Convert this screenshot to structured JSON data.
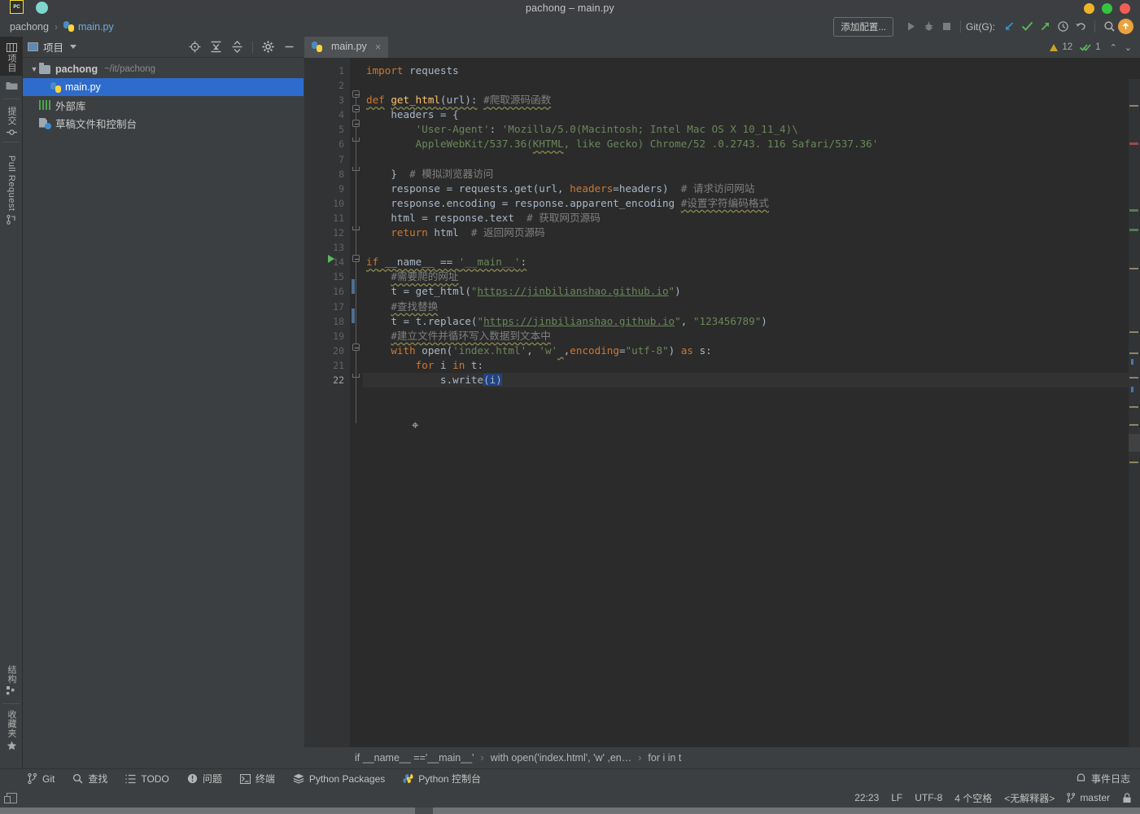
{
  "window": {
    "title": "pachong – main.py",
    "app_icon": "pycharm-logo-icon"
  },
  "navbar": {
    "project_crumb": "pachong",
    "separator": "›",
    "file_crumb": "main.py",
    "add_config_label": "添加配置...",
    "git_label": "Git(G):"
  },
  "toolstrip": {
    "top_items": [
      {
        "label": "项目",
        "icon": "project-icon",
        "active": true
      },
      {
        "label": "",
        "icon": "folder-icon",
        "active": false
      },
      {
        "label": "提交",
        "icon": "commit-icon",
        "active": false
      },
      {
        "label": "Pull Request",
        "icon": "pull-request-icon",
        "active": false
      }
    ],
    "bottom_items": [
      {
        "label": "结构",
        "icon": "structure-icon"
      },
      {
        "label": "收藏夹",
        "icon": "star-icon"
      }
    ]
  },
  "project_panel": {
    "title": "项目",
    "header_icons": [
      "locate-icon",
      "expand-all-icon",
      "collapse-all-icon",
      "gear-icon",
      "hide-icon"
    ],
    "tree": [
      {
        "label": "pachong",
        "path": "~/it/pachong",
        "icon": "folder-icon",
        "depth": 0,
        "expanded": true,
        "selected": false
      },
      {
        "label": "main.py",
        "path": "",
        "icon": "python-file-icon",
        "depth": 1,
        "expanded": false,
        "selected": true
      },
      {
        "label": "外部库",
        "path": "",
        "icon": "library-icon",
        "depth": 0,
        "expanded": false,
        "selected": false
      },
      {
        "label": "草稿文件和控制台",
        "path": "",
        "icon": "scratches-icon",
        "depth": 0,
        "expanded": false,
        "selected": false
      }
    ]
  },
  "editor": {
    "tab": {
      "label": "main.py",
      "icon": "python-file-icon",
      "close": "×"
    },
    "inspection": {
      "warning_count": "12",
      "check_count": "1",
      "up": "⌃",
      "down": "⌄"
    },
    "first_line": 1,
    "last_line": 22,
    "current_line": 22,
    "run_marker_line": 14,
    "changed_lines": [
      16,
      18
    ],
    "lines": [
      "import requests",
      "",
      "def get_html(url): #爬取源码函数",
      "    headers = {",
      "        'User-Agent': 'Mozilla/5.0(Macintosh; Intel Mac OS X 10_11_4)\\",
      "        AppleWebKit/537.36(KHTML, like Gecko) Chrome/52 .0.2743. 116 Safari/537.36'",
      "",
      "    }  # 模拟浏览器访问",
      "    response = requests.get(url, headers=headers)  # 请求访问网站",
      "    response.encoding = response.apparent_encoding #设置字符编码格式",
      "    html = response.text  # 获取网页源码",
      "    return html  # 返回网页源码",
      "",
      "if __name__ == '__main__':",
      "    #需要爬的网址",
      "    t = get_html(\"https://jinbilianshao.github.io\")",
      "    #查找替换",
      "    t = t.replace(\"https://jinbilianshao.github.io\", \"123456789\")",
      "    #建立文件并循环写入数据到文本中",
      "    with open('index.html', 'w' ,encoding=\"utf-8\") as s:",
      "        for i in t:",
      "            s.write(i)"
    ]
  },
  "bottom_breadcrumb": {
    "items": [
      "if __name__ =='__main__'",
      "with open('index.html', 'w' ,en…",
      "for i in t"
    ],
    "separator": "›"
  },
  "bottom_toolbar": {
    "items": [
      {
        "label": "Git",
        "icon": "git-branch-icon"
      },
      {
        "label": "查找",
        "icon": "search-icon"
      },
      {
        "label": "TODO",
        "icon": "todo-list-icon"
      },
      {
        "label": "问题",
        "icon": "problems-icon"
      },
      {
        "label": "终端",
        "icon": "terminal-icon"
      },
      {
        "label": "Python Packages",
        "icon": "packages-icon"
      },
      {
        "label": "Python 控制台",
        "icon": "python-console-icon"
      }
    ],
    "event_log": {
      "label": "事件日志",
      "icon": "notification-icon"
    }
  },
  "statusbar": {
    "cursor_position": "22:23",
    "line_separator": "LF",
    "encoding": "UTF-8",
    "indent": "4 个空格",
    "interpreter": "<无解释器>",
    "branch": "master",
    "branch_icon": "git-branch-icon",
    "lock_icon": "lock-icon"
  },
  "colors": {
    "bg_panel": "#3c3f41",
    "bg_editor": "#2b2b2b",
    "accent_select": "#2d6ccc",
    "keyword": "#cc7832",
    "string": "#6a8759",
    "comment": "#808080",
    "function": "#ffc66d",
    "number": "#6897bb",
    "warning": "#c9a227",
    "update_badge": "#e8a33d"
  }
}
